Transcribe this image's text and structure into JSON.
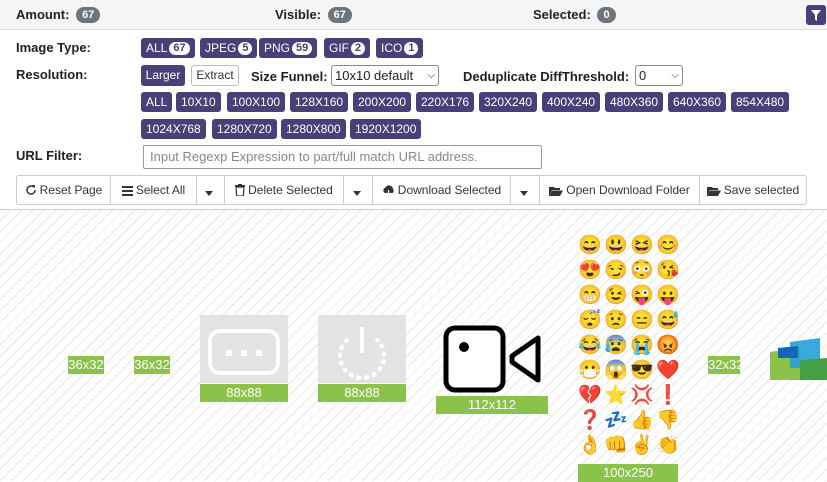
{
  "stats": {
    "amount_label": "Amount:",
    "amount": "67",
    "visible_label": "Visible:",
    "visible": "67",
    "selected_label": "Selected:",
    "selected": "0"
  },
  "filters": {
    "image_type_label": "Image Type:",
    "types": [
      {
        "label": "ALL",
        "count": "67"
      },
      {
        "label": "JPEG",
        "count": "5"
      },
      {
        "label": "PNG",
        "count": "59"
      },
      {
        "label": "GIF",
        "count": "2"
      },
      {
        "label": "ICO",
        "count": "1"
      }
    ],
    "resolution_label": "Resolution:",
    "larger": "Larger",
    "extract": "Extract",
    "size_funnel_label": "Size Funnel:",
    "size_funnel_value": "10x10 default",
    "dedup_label": "Deduplicate DiffThreshold:",
    "dedup_value": "0",
    "resolutions": [
      "ALL",
      "10X10",
      "100X100",
      "128X160",
      "200X200",
      "220X176",
      "320X240",
      "400X240",
      "480X360",
      "640X360",
      "854X480",
      "1024X768",
      "1280X720",
      "1280X800",
      "1920X1200"
    ],
    "url_filter_label": "URL Filter:",
    "url_placeholder": "Input Regexp Expression to part/full match URL address."
  },
  "toolbar": {
    "reset": "Reset Page",
    "select_all": "Select All",
    "delete_selected": "Delete Selected",
    "download_selected": "Download Selected",
    "open_folder": "Open Download Folder",
    "save_selected": "Save selected"
  },
  "gallery": {
    "items": [
      "36x32",
      "36x32",
      "88x88",
      "88x88",
      "112x112",
      "100x250",
      "32x32"
    ],
    "emojis": [
      "😄",
      "😃",
      "😆",
      "😊",
      "😍",
      "😏",
      "😳",
      "😘",
      "😁",
      "😉",
      "😜",
      "😛",
      "😴",
      "😟",
      "😑",
      "😅",
      "😂",
      "😰",
      "😭",
      "😡",
      "😷",
      "😱",
      "😎",
      "❤️",
      "💔",
      "⭐",
      "💢",
      "❗",
      "❓",
      "💤",
      "👍",
      "👎",
      "👌",
      "👊",
      "✌️",
      "👏"
    ]
  },
  "colors": {
    "accent": "#4b3f7a",
    "size_label": "#8bc34a",
    "badge": "#6c757d"
  }
}
